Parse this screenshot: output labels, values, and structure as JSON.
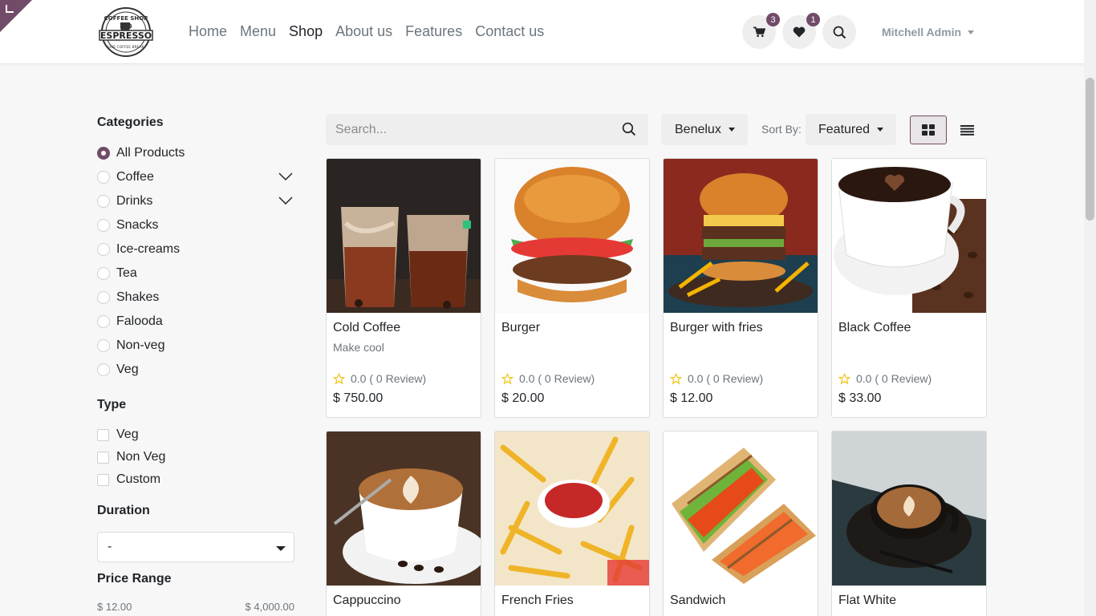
{
  "header": {
    "nav": [
      {
        "label": "Home",
        "active": false
      },
      {
        "label": "Menu",
        "active": false
      },
      {
        "label": "Shop",
        "active": true
      },
      {
        "label": "About us",
        "active": false
      },
      {
        "label": "Features",
        "active": false
      },
      {
        "label": "Contact us",
        "active": false
      }
    ],
    "cart_count": "3",
    "wishlist_count": "1",
    "user_name": "Mitchell Admin",
    "logo_text": [
      "COFFEE SHOP",
      "ESPRESSO",
      "ONE COFFEE BREAK"
    ],
    "accent_color": "#714b67"
  },
  "sidebar": {
    "categories_title": "Categories",
    "categories": [
      "All Products",
      "Coffee",
      "Drinks",
      "Snacks",
      "Ice-creams",
      "Tea",
      "Shakes",
      "Falooda",
      "Non-veg",
      "Veg"
    ],
    "selected_category": "All Products",
    "expandable": [
      "Coffee",
      "Drinks"
    ],
    "type_title": "Type",
    "types": [
      "Veg",
      "Non Veg",
      "Custom"
    ],
    "duration_title": "Duration",
    "duration_value": "-",
    "price_title": "Price Range",
    "price_min": "$ 12.00",
    "price_max": "$ 4,000.00"
  },
  "toolbar": {
    "search_placeholder": "Search...",
    "pricelist": "Benelux",
    "sort_label": "Sort By:",
    "sort_value": "Featured",
    "view_mode": "grid"
  },
  "products": [
    {
      "name": "Cold Coffee",
      "desc": "Make cool",
      "rating": "0.0 ( 0 Review)",
      "price": "$ 750.00",
      "image": "cold-coffee"
    },
    {
      "name": "Burger",
      "desc": "",
      "rating": "0.0 ( 0 Review)",
      "price": "$ 20.00",
      "image": "burger"
    },
    {
      "name": "Burger with fries",
      "desc": "",
      "rating": "0.0 ( 0 Review)",
      "price": "$ 12.00",
      "image": "burger-with-fries"
    },
    {
      "name": "Black Coffee",
      "desc": "",
      "rating": "0.0 ( 0 Review)",
      "price": "$ 33.00",
      "image": "black-coffee"
    },
    {
      "name": "Cappuccino",
      "desc": "",
      "rating": "",
      "price": "",
      "image": "cappuccino"
    },
    {
      "name": "French Fries",
      "desc": "",
      "rating": "",
      "price": "",
      "image": "french-fries"
    },
    {
      "name": "Sandwich",
      "desc": "",
      "rating": "",
      "price": "",
      "image": "sandwich"
    },
    {
      "name": "Flat White",
      "desc": "",
      "rating": "",
      "price": "",
      "image": "flat-white"
    }
  ]
}
